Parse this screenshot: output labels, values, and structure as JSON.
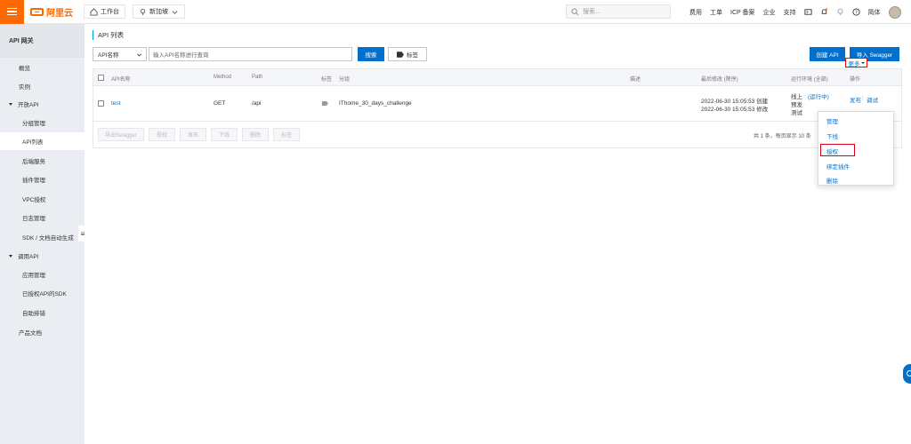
{
  "topbar": {
    "logo_text": "阿里云",
    "workbench": "工作台",
    "region": "新加坡",
    "search_placeholder": "搜索...",
    "links": [
      "费用",
      "工单",
      "ICP 备案",
      "企业",
      "支持"
    ],
    "language": "简体"
  },
  "sidebar": {
    "title": "API 网关",
    "items": [
      {
        "label": "概览"
      },
      {
        "label": "实例"
      },
      {
        "label": "开放API"
      },
      {
        "label": "分组管理"
      },
      {
        "label": "API列表"
      },
      {
        "label": "后端服务"
      },
      {
        "label": "插件管理"
      },
      {
        "label": "VPC授权"
      },
      {
        "label": "日志管理"
      },
      {
        "label": "SDK / 文档自动生成"
      },
      {
        "label": "调用API"
      },
      {
        "label": "应用管理"
      },
      {
        "label": "已授权API的SDK"
      },
      {
        "label": "自助排错"
      },
      {
        "label": "产品文档"
      }
    ]
  },
  "main": {
    "breadcrumb": "API 列表",
    "filter_select": "API名称",
    "search_placeholder": "输入API名称进行查询",
    "search_button": "搜索",
    "tag_button": "标签",
    "create_api": "创建 API",
    "import_swagger": "导入 Swagger",
    "columns": {
      "name": "API名称",
      "method": "Method",
      "path": "Path",
      "tag": "标签",
      "group": "分组",
      "desc": "描述",
      "modified": "最后修改 (降序)",
      "env": "运行环境 (全部)",
      "actions": "操作"
    },
    "row": {
      "name": "test",
      "method": "GET",
      "path": "/api",
      "group": "IThome_30_days_challenge",
      "created": "2022-06-30 15:05:53 创建",
      "modified": "2022-06-30 15:05:53 修改",
      "env_online": "线上",
      "env_running": "(运行中)",
      "env_pre": "预发",
      "env_test": "测试",
      "action_publish": "发布",
      "action_debug": "调试",
      "action_more": "更多"
    },
    "footer_buttons": [
      "导出Swagger",
      "授权",
      "发布",
      "下线",
      "删除",
      "标签"
    ],
    "pager_text": "共 1 条，每页显示 10 条",
    "dropdown": [
      "管理",
      "下线",
      "授权",
      "绑定插件",
      "删除"
    ]
  }
}
